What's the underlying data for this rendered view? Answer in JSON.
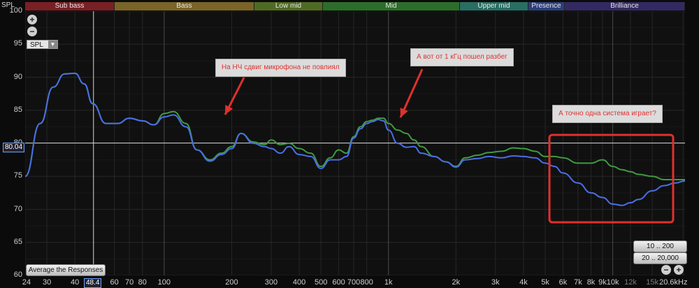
{
  "header": {
    "spl_label": "SPL",
    "bands": [
      {
        "label": "Sub bass",
        "color": "#7a1f24"
      },
      {
        "label": "Bass",
        "color": "#7a6428"
      },
      {
        "label": "Low mid",
        "color": "#4f6b23"
      },
      {
        "label": "Mid",
        "color": "#2d6d2b"
      },
      {
        "label": "Upper mid",
        "color": "#296e62"
      },
      {
        "label": "Presence",
        "color": "#2c3f7a"
      },
      {
        "label": "Brilliance",
        "color": "#332a63"
      }
    ]
  },
  "controls": {
    "zoom_in_top": "+",
    "zoom_out_top": "−",
    "spl_select": "SPL",
    "average_button": "Average the Responses",
    "range_10_200": "10 .. 200",
    "range_20_20000": "20 .. 20,000",
    "zoom_out_bottom": "−",
    "zoom_in_bottom": "+"
  },
  "cursor": {
    "spl_value": "80.04",
    "freq_value": "48.4"
  },
  "annotations": {
    "note_lf": "На НЧ сдвиг микрофона не повлиял",
    "note_1k": "А вот от 1 кГц пошел разбег",
    "note_system": "А точно одна система играет?"
  },
  "colors": {
    "blue_trace": "#4a6ee8",
    "green_trace": "#3f9a3f",
    "highlight_box": "#e0302c",
    "arrow": "#e0302c"
  },
  "chart_data": {
    "type": "line",
    "xscale": "log",
    "xlim": [
      24,
      21000
    ],
    "ylim": [
      60,
      100
    ],
    "ylabel": "SPL",
    "yticks": [
      60,
      65,
      70,
      75,
      80,
      85,
      90,
      95,
      100
    ],
    "xticks": [
      {
        "f": 24,
        "label": "24"
      },
      {
        "f": 30,
        "label": "30"
      },
      {
        "f": 40,
        "label": "40"
      },
      {
        "f": 60,
        "label": "60"
      },
      {
        "f": 70,
        "label": "70"
      },
      {
        "f": 80,
        "label": "80"
      },
      {
        "f": 100,
        "label": "100"
      },
      {
        "f": 200,
        "label": "200"
      },
      {
        "f": 300,
        "label": "300"
      },
      {
        "f": 400,
        "label": "400"
      },
      {
        "f": 500,
        "label": "500"
      },
      {
        "f": 600,
        "label": "600"
      },
      {
        "f": 700,
        "label": "700"
      },
      {
        "f": 800,
        "label": "800"
      },
      {
        "f": 1000,
        "label": "1k"
      },
      {
        "f": 2000,
        "label": "2k"
      },
      {
        "f": 3000,
        "label": "3k"
      },
      {
        "f": 4000,
        "label": "4k"
      },
      {
        "f": 5000,
        "label": "5k"
      },
      {
        "f": 6000,
        "label": "6k"
      },
      {
        "f": 7000,
        "label": "7k"
      },
      {
        "f": 8000,
        "label": "8k"
      },
      {
        "f": 9000,
        "label": "9k"
      },
      {
        "f": 10000,
        "label": "10k"
      },
      {
        "f": 12000,
        "label": "12k",
        "dim": true
      },
      {
        "f": 15000,
        "label": "15k",
        "dim": true
      },
      {
        "f": 20600,
        "label": "20.6kHz"
      }
    ],
    "cursor": {
      "x": 48.4,
      "y": 80.04
    },
    "series": [
      {
        "color": "#4a6ee8",
        "points": [
          [
            24,
            75
          ],
          [
            28,
            83
          ],
          [
            32,
            88.5
          ],
          [
            36,
            90.5
          ],
          [
            40,
            90.6
          ],
          [
            44,
            89
          ],
          [
            48,
            86
          ],
          [
            55,
            83
          ],
          [
            62,
            83
          ],
          [
            70,
            83.8
          ],
          [
            80,
            83.4
          ],
          [
            90,
            82.8
          ],
          [
            100,
            84
          ],
          [
            110,
            84.3
          ],
          [
            125,
            82.5
          ],
          [
            140,
            79
          ],
          [
            160,
            77.3
          ],
          [
            180,
            78.3
          ],
          [
            200,
            79.2
          ],
          [
            220,
            81.5
          ],
          [
            250,
            80
          ],
          [
            280,
            79.5
          ],
          [
            300,
            79.2
          ],
          [
            330,
            78.5
          ],
          [
            360,
            79.5
          ],
          [
            400,
            78.3
          ],
          [
            450,
            78
          ],
          [
            500,
            76.2
          ],
          [
            550,
            77.5
          ],
          [
            600,
            77.5
          ],
          [
            650,
            78
          ],
          [
            700,
            80.8
          ],
          [
            750,
            82.2
          ],
          [
            800,
            83
          ],
          [
            850,
            83.3
          ],
          [
            900,
            83.6
          ],
          [
            950,
            83.4
          ],
          [
            1000,
            82
          ],
          [
            1100,
            80
          ],
          [
            1200,
            79.4
          ],
          [
            1300,
            79.5
          ],
          [
            1400,
            78.5
          ],
          [
            1600,
            78
          ],
          [
            1800,
            77.2
          ],
          [
            2000,
            76.4
          ],
          [
            2200,
            77.5
          ],
          [
            2500,
            77.7
          ],
          [
            2800,
            78
          ],
          [
            3200,
            77.8
          ],
          [
            3600,
            78.1
          ],
          [
            4000,
            78
          ],
          [
            4500,
            77.8
          ],
          [
            5000,
            77
          ],
          [
            5500,
            76.5
          ],
          [
            6000,
            75.5
          ],
          [
            7000,
            74
          ],
          [
            8000,
            72.5
          ],
          [
            9000,
            71.8
          ],
          [
            10000,
            70.8
          ],
          [
            11000,
            70.6
          ],
          [
            12000,
            71
          ],
          [
            13000,
            71.5
          ],
          [
            15000,
            72.8
          ],
          [
            17000,
            73.6
          ],
          [
            19000,
            74
          ],
          [
            21000,
            74.3
          ]
        ]
      },
      {
        "color": "#3f9a3f",
        "points": [
          [
            24,
            75
          ],
          [
            28,
            83
          ],
          [
            32,
            88.5
          ],
          [
            36,
            90.5
          ],
          [
            40,
            90.6
          ],
          [
            44,
            89
          ],
          [
            48,
            86
          ],
          [
            55,
            83
          ],
          [
            62,
            83
          ],
          [
            70,
            83.8
          ],
          [
            80,
            83.4
          ],
          [
            90,
            82.8
          ],
          [
            100,
            84.5
          ],
          [
            110,
            84.8
          ],
          [
            125,
            83
          ],
          [
            140,
            79
          ],
          [
            160,
            77.5
          ],
          [
            180,
            78.5
          ],
          [
            200,
            79.5
          ],
          [
            220,
            81.5
          ],
          [
            250,
            80.2
          ],
          [
            280,
            79.8
          ],
          [
            300,
            80.5
          ],
          [
            330,
            79.8
          ],
          [
            360,
            80
          ],
          [
            400,
            79.2
          ],
          [
            450,
            78.5
          ],
          [
            500,
            76.5
          ],
          [
            550,
            77.8
          ],
          [
            600,
            79
          ],
          [
            650,
            78.5
          ],
          [
            700,
            81
          ],
          [
            750,
            82.5
          ],
          [
            800,
            83.3
          ],
          [
            850,
            83.5
          ],
          [
            900,
            83.8
          ],
          [
            950,
            83.8
          ],
          [
            1000,
            83
          ],
          [
            1100,
            82
          ],
          [
            1200,
            81.5
          ],
          [
            1300,
            80.5
          ],
          [
            1400,
            79.5
          ],
          [
            1600,
            78
          ],
          [
            1800,
            77.2
          ],
          [
            2000,
            76.5
          ],
          [
            2200,
            77.8
          ],
          [
            2500,
            78.2
          ],
          [
            2800,
            78.6
          ],
          [
            3200,
            78.8
          ],
          [
            3600,
            79.3
          ],
          [
            4000,
            79.2
          ],
          [
            4500,
            78.8
          ],
          [
            5000,
            78
          ],
          [
            5500,
            78
          ],
          [
            6000,
            77.8
          ],
          [
            7000,
            77
          ],
          [
            8000,
            77
          ],
          [
            9000,
            77.5
          ],
          [
            10000,
            76.5
          ],
          [
            11000,
            76
          ],
          [
            12000,
            75.7
          ],
          [
            13000,
            75.3
          ],
          [
            15000,
            75
          ],
          [
            17000,
            74.5
          ],
          [
            19000,
            74.5
          ],
          [
            21000,
            74.5
          ]
        ]
      }
    ]
  }
}
